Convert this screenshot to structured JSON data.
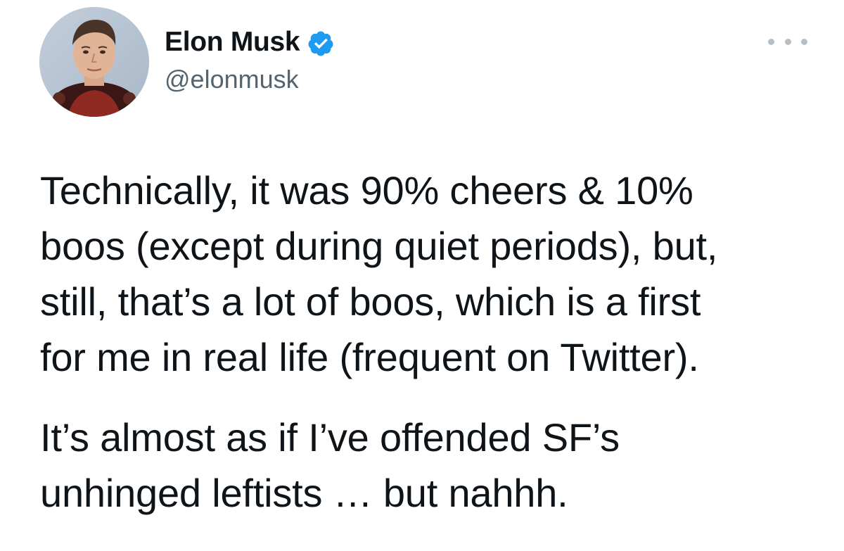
{
  "author": {
    "name": "Elon Musk",
    "handle": "@elonmusk",
    "verified": true,
    "avatar_icon": "profile-photo",
    "verified_icon": "verified-badge-icon",
    "verified_color": "#1d9bf0"
  },
  "menu": {
    "icon": "more-horizontal-icon"
  },
  "tweet": {
    "paragraphs": [
      {
        "lines": [
          "Technically, it was 90% cheers & 10%",
          "boos (except during quiet periods), but,",
          "still, that’s a lot of boos, which is a first",
          "for me in real life (frequent on Twitter)."
        ]
      },
      {
        "lines": [
          "It’s almost as if I’ve offended SF’s",
          "unhinged leftists … but nahhh."
        ]
      }
    ]
  },
  "colors": {
    "text": "#0f1419",
    "secondary": "#536471",
    "background": "#ffffff"
  }
}
